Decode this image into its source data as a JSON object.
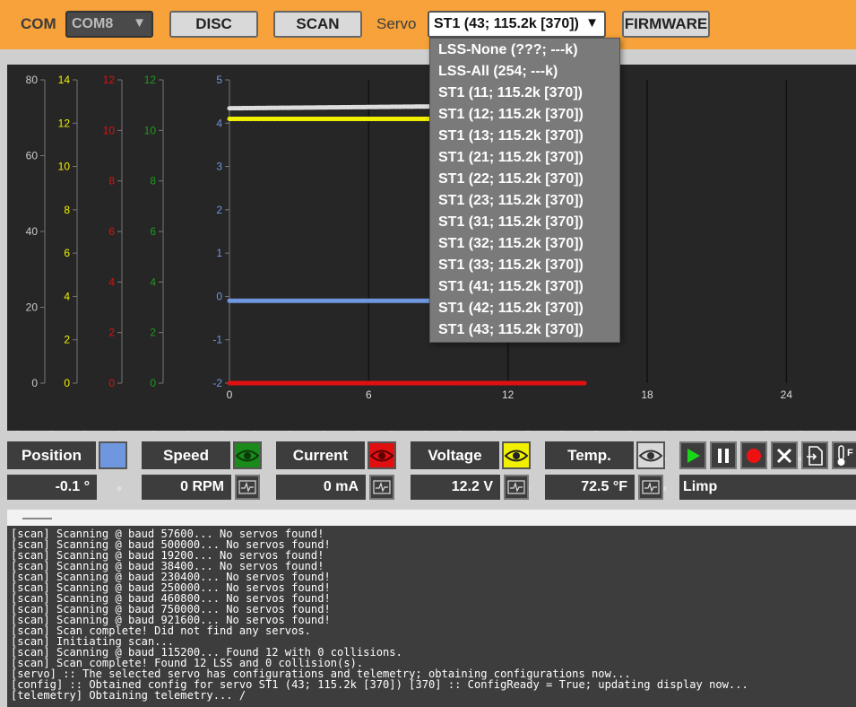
{
  "topbar": {
    "com_label": "COM",
    "com_port": "COM8",
    "disc_label": "DISC",
    "scan_label": "SCAN",
    "servo_label": "Servo",
    "servo_selected": "ST1 (43; 115.2k [370])",
    "firmware_label": "FIRMWARE",
    "accent_color": "#f7a23a"
  },
  "dropdown": {
    "items": [
      "LSS-None (???; ---k)",
      "LSS-All (254; ---k)",
      "ST1 (11; 115.2k [370])",
      "ST1 (12; 115.2k [370])",
      "ST1 (13; 115.2k [370])",
      "ST1 (21; 115.2k [370])",
      "ST1 (22; 115.2k [370])",
      "ST1 (23; 115.2k [370])",
      "ST1 (31; 115.2k [370])",
      "ST1 (32; 115.2k [370])",
      "ST1 (33; 115.2k [370])",
      "ST1 (41; 115.2k [370])",
      "ST1 (42; 115.2k [370])",
      "ST1 (43; 115.2k [370])"
    ]
  },
  "chart_data": {
    "type": "line",
    "axes": [
      {
        "color": "#cccccc",
        "ticks": [
          "80",
          "60",
          "40",
          "20",
          "0"
        ],
        "range": [
          0,
          80
        ]
      },
      {
        "color": "#f0f000",
        "ticks": [
          "14",
          "12",
          "10",
          "8",
          "6",
          "4",
          "2",
          "0"
        ],
        "range": [
          0,
          14
        ]
      },
      {
        "color": "#e01010",
        "ticks": [
          "12",
          "10",
          "8",
          "6",
          "4",
          "2",
          "0"
        ],
        "range": [
          0,
          12
        ]
      },
      {
        "color": "#1f9a1f",
        "ticks": [
          "12",
          "10",
          "8",
          "6",
          "4",
          "2",
          "0"
        ],
        "range": [
          0,
          12
        ]
      },
      {
        "color": "#6f97e0",
        "ticks": [
          "5",
          "4",
          "3",
          "2",
          "1",
          "0",
          "-1",
          "-2"
        ],
        "range": [
          -2,
          5
        ]
      }
    ],
    "x_ticks": [
      "0",
      "6",
      "12",
      "18",
      "24"
    ],
    "xlim": [
      0,
      27
    ],
    "series": [
      {
        "color": "#dddddd",
        "axis": 0,
        "x": [
          0,
          9
        ],
        "y": [
          72.5,
          73.0
        ]
      },
      {
        "color": "#f0f000",
        "axis": 1,
        "x": [
          0,
          9
        ],
        "y": [
          12.2,
          12.2
        ]
      },
      {
        "color": "#6f97e0",
        "axis": 4,
        "x": [
          0,
          9
        ],
        "y": [
          -0.1,
          -0.1
        ]
      },
      {
        "color": "#e01010",
        "axis": 2,
        "x": [
          0,
          15.3
        ],
        "y": [
          0,
          0
        ]
      }
    ]
  },
  "telemetry": {
    "position": {
      "label": "Position",
      "value": "-0.1 °",
      "color": "#6f97e0"
    },
    "speed": {
      "label": "Speed",
      "value": "0 RPM",
      "color": "#1a8a1a"
    },
    "current": {
      "label": "Current",
      "value": "0 mA",
      "color": "#e01010"
    },
    "voltage": {
      "label": "Voltage",
      "value": "12.2 V",
      "color": "#f0f000"
    },
    "temp": {
      "label": "Temp.",
      "value": "72.5 °F",
      "color": "#d8d8d8"
    },
    "status": "Limp"
  },
  "log": {
    "lines": [
      "[scan] Scanning @ baud 57600... No servos found!",
      "[scan] Scanning @ baud 500000... No servos found!",
      "[scan] Scanning @ baud 19200... No servos found!",
      "[scan] Scanning @ baud 38400... No servos found!",
      "[scan] Scanning @ baud 230400... No servos found!",
      "[scan] Scanning @ baud 250000... No servos found!",
      "[scan] Scanning @ baud 460800... No servos found!",
      "[scan] Scanning @ baud 750000... No servos found!",
      "[scan] Scanning @ baud 921600... No servos found!",
      "[scan] Scan complete! Did not find any servos.",
      "[scan] Initiating scan...",
      "[scan] Scanning @ baud 115200... Found 12 with 0 collisions.",
      "[scan] Scan complete! Found 12 LSS and 0 collision(s).",
      "[servo] :: The selected servo has configurations and telemetry; obtaining configurations now...",
      "[config] :: Obtained config for servo ST1 (43; 115.2k [370]) [370] :: ConfigReady = True; updating display now...",
      "[telemetry] Obtaining telemetry... /"
    ]
  }
}
